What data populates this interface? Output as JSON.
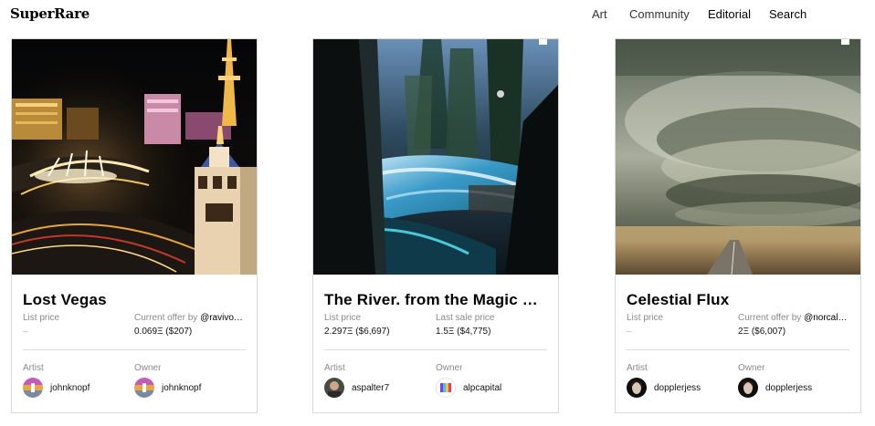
{
  "header": {
    "logo": "SuperRare",
    "nav": [
      "Art",
      "Community",
      "Editorial",
      "Search"
    ]
  },
  "cards": [
    {
      "title": "Lost Vegas",
      "left_label": "List price",
      "left_value": "–",
      "right_label": "Current offer by",
      "right_user": "@ravivo…",
      "right_value": "0.069Ξ ($207)",
      "artist_label": "Artist",
      "artist": "johnknopf",
      "owner_label": "Owner",
      "owner": "johnknopf"
    },
    {
      "title": "The River. from the Magic …",
      "left_label": "List price",
      "left_value": "2.297Ξ ($6,697)",
      "right_label": "Last sale price",
      "right_user": "",
      "right_value": "1.5Ξ ($4,775)",
      "artist_label": "Artist",
      "artist": "aspalter7",
      "owner_label": "Owner",
      "owner": "alpcapital"
    },
    {
      "title": "Celestial Flux",
      "left_label": "List price",
      "left_value": "–",
      "right_label": "Current offer by",
      "right_user": "@norcal…",
      "right_value": "2Ξ ($6,007)",
      "artist_label": "Artist",
      "artist": "dopplerjess",
      "owner_label": "Owner",
      "owner": "dopplerjess"
    }
  ]
}
